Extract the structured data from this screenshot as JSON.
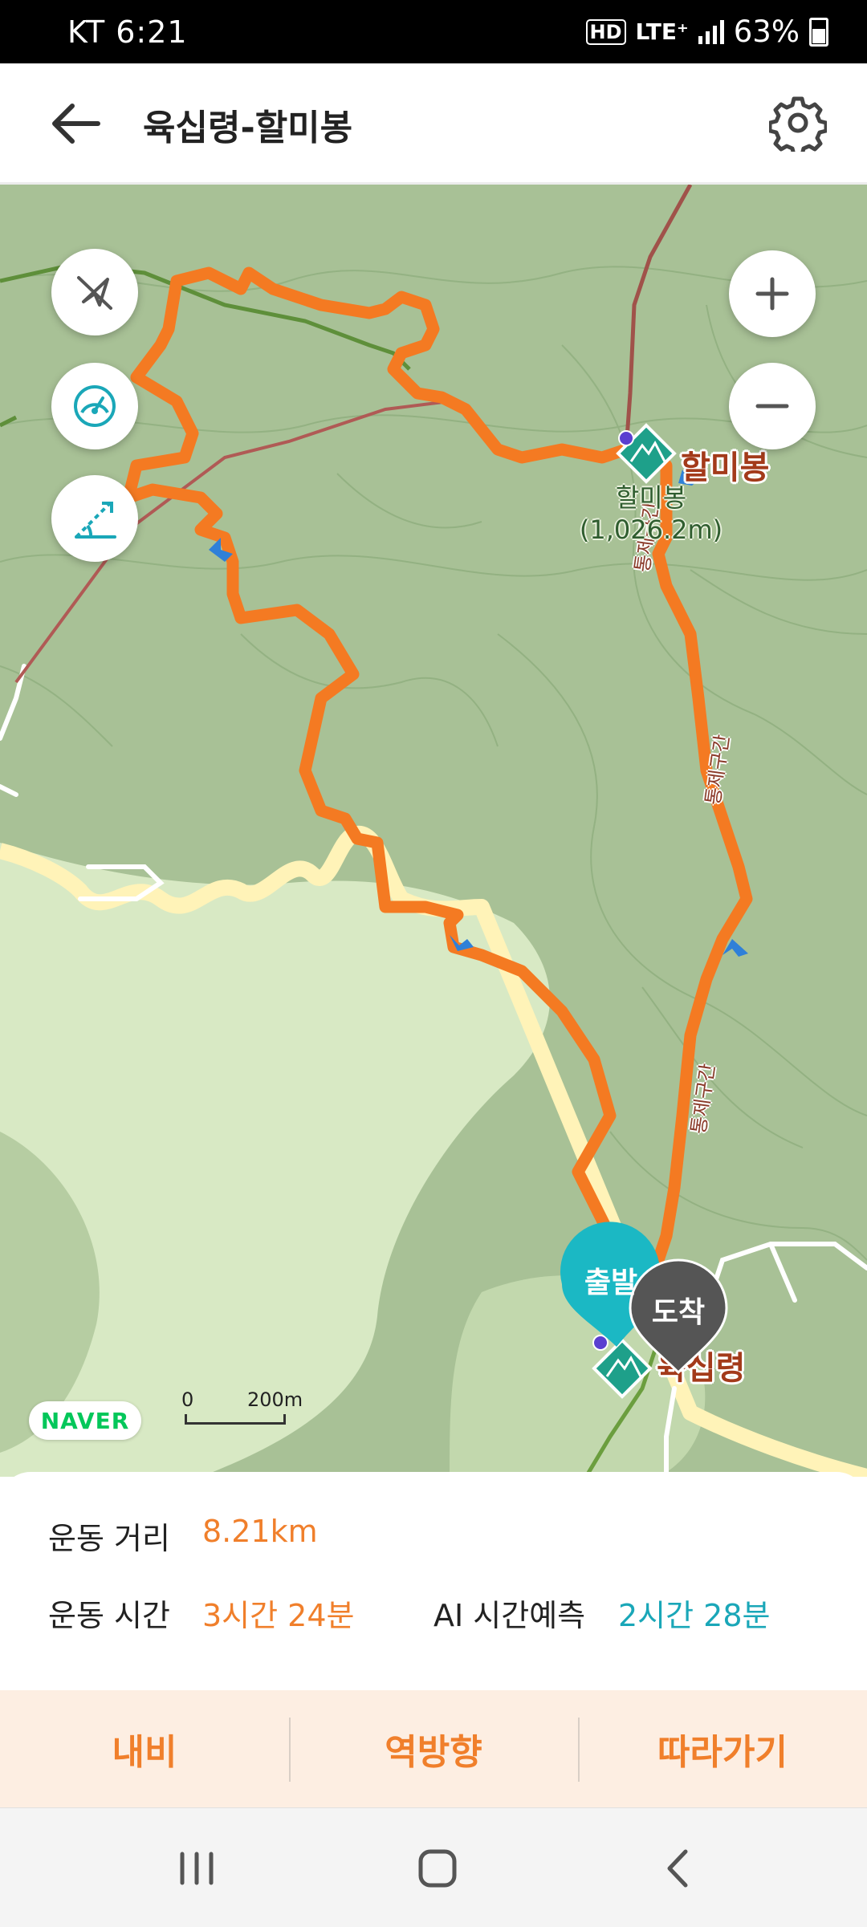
{
  "status_bar": {
    "carrier_time": "KT 6:21",
    "net_badge": "HD",
    "network": "LTE⁺",
    "battery": "63%"
  },
  "header": {
    "title": "육십령-할미봉"
  },
  "map": {
    "peak_name": "할미봉",
    "peak_elevation_name": "할미봉",
    "peak_elevation": "(1,026.2m)",
    "trail_label_1": "통제구간",
    "trail_label_2": "통제구간",
    "trail_label_3": "통제구간",
    "start_pin": "출발",
    "end_pin": "도착",
    "end_place": "육십령",
    "naver_logo": "NAVER",
    "scale_zero": "0",
    "scale_distance": "200m"
  },
  "stats": {
    "distance_label": "운동 거리",
    "distance_value": "8.21km",
    "time_label": "운동 시간",
    "time_value": "3시간 24분",
    "ai_label": "AI 시간예측",
    "ai_value": "2시간 28분"
  },
  "actions": {
    "navi": "내비",
    "reverse": "역방향",
    "follow": "따라가기"
  },
  "colors": {
    "route": "#f47a22",
    "accent_orange": "#f07f2b",
    "accent_teal": "#1aa7b8",
    "start_pin": "#1bb8c4",
    "end_pin": "#555555"
  }
}
